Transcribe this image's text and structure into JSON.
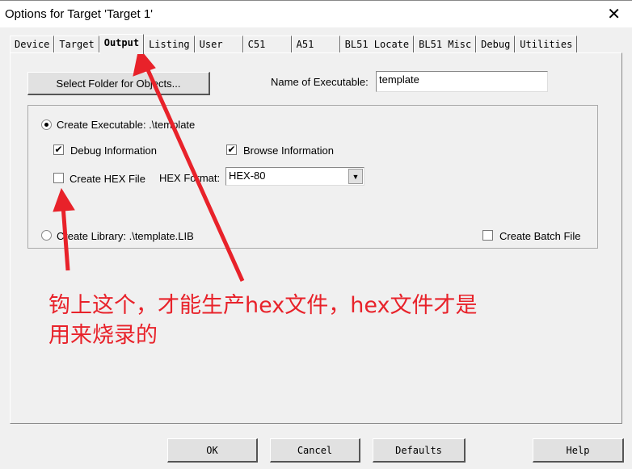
{
  "window": {
    "title": "Options for Target 'Target 1'",
    "close": "✕"
  },
  "tabs": [
    "Device",
    "Target",
    "Output",
    "Listing",
    "User",
    "C51",
    "A51",
    "BL51 Locate",
    "BL51 Misc",
    "Debug",
    "Utilities"
  ],
  "active_tab": "Output",
  "output": {
    "select_folder_label": "Select Folder for Objects...",
    "name_exec_label": "Name of Executable:",
    "name_exec_value": "template",
    "create_exec_label": "Create Executable:  .\\template",
    "create_exec_selected": true,
    "debug_info_label": "Debug Information",
    "debug_info_checked": true,
    "browse_info_label": "Browse Information",
    "browse_info_checked": true,
    "create_hex_label": "Create HEX File",
    "create_hex_checked": false,
    "hex_format_label": "HEX Format:",
    "hex_format_value": "HEX-80",
    "create_lib_label": "Create Library:  .\\template.LIB",
    "create_lib_selected": false,
    "batch_label": "Create Batch File",
    "batch_checked": false
  },
  "annotation": {
    "line1": "钩上这个，才能生产hex文件，hex文件才是",
    "line2": "用来烧录的",
    "color": "#e8222a"
  },
  "buttons": {
    "ok": "OK",
    "cancel": "Cancel",
    "defaults": "Defaults",
    "help": "Help"
  }
}
